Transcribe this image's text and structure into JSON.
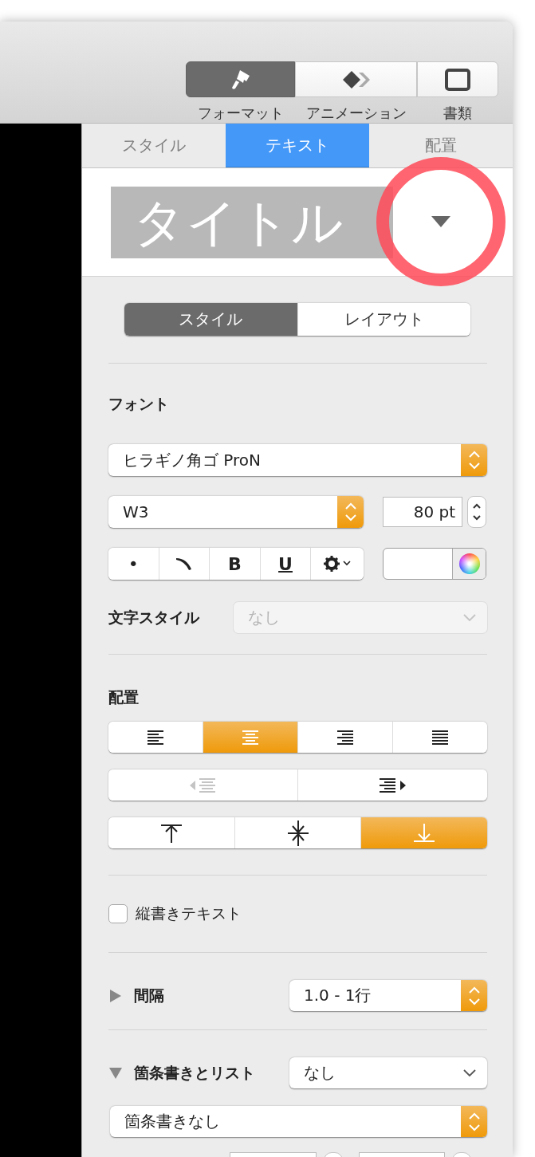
{
  "toolbar": {
    "buttons": [
      {
        "kind": "brush",
        "label": "フォーマット",
        "selected": true
      },
      {
        "kind": "animate",
        "label": "アニメーション",
        "selected": false
      },
      {
        "kind": "document",
        "label": "書類",
        "selected": false
      }
    ]
  },
  "tabs": [
    {
      "label": "スタイル",
      "selected": false
    },
    {
      "label": "テキスト",
      "selected": true
    },
    {
      "label": "配置",
      "selected": false
    }
  ],
  "paragraph_style": {
    "value": "タイトル"
  },
  "sub_tabs": [
    {
      "label": "スタイル",
      "selected": true
    },
    {
      "label": "レイアウト",
      "selected": false
    }
  ],
  "font": {
    "label": "フォント",
    "family": "ヒラギノ角ゴ ProN",
    "typeface": "W3",
    "size": "80 pt",
    "style_buttons": [
      {
        "kind": "text",
        "label": "•"
      },
      {
        "kind": "curve"
      },
      {
        "kind": "bold",
        "label": "B"
      },
      {
        "kind": "underline",
        "label": "U"
      },
      {
        "kind": "gear"
      }
    ]
  },
  "character_style": {
    "label": "文字スタイル",
    "value": "なし",
    "disabled": true
  },
  "alignment": {
    "label": "配置",
    "horizontal": [
      {
        "kind": "left",
        "selected": false
      },
      {
        "kind": "center",
        "selected": true
      },
      {
        "kind": "right",
        "selected": false
      },
      {
        "kind": "justify",
        "selected": false
      }
    ],
    "indent": [
      {
        "kind": "decrease",
        "disabled": true
      },
      {
        "kind": "increase",
        "disabled": false
      }
    ],
    "vertical": [
      {
        "kind": "top",
        "selected": false
      },
      {
        "kind": "middle",
        "selected": false
      },
      {
        "kind": "bottom",
        "selected": true
      }
    ]
  },
  "vertical_text": {
    "label": "縦書きテキスト",
    "checked": false
  },
  "spacing": {
    "label": "間隔",
    "expanded": false,
    "value": "1.0 - 1行"
  },
  "bullets": {
    "label": "箇条書きとリスト",
    "expanded": true,
    "value": "なし",
    "style": "箇条書きなし"
  }
}
